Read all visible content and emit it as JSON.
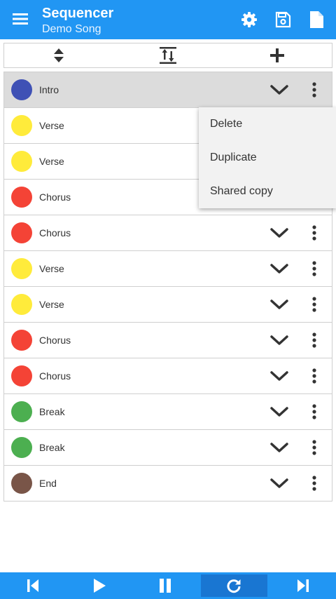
{
  "app": {
    "title": "Sequencer",
    "subtitle": "Demo Song"
  },
  "colors": {
    "primary": "#2196f3",
    "primary_dark": "#1976d2",
    "yellow": "#ffeb3b",
    "red": "#f44336",
    "indigo": "#3f51b5",
    "green": "#4caf50",
    "brown": "#795548"
  },
  "toolbar": {
    "icons": [
      "sort-icon",
      "vertical-expand-icon",
      "add-icon"
    ]
  },
  "rows": [
    {
      "label": "Intro",
      "color": "#3f51b5",
      "selected": true
    },
    {
      "label": "Verse",
      "color": "#ffeb3b"
    },
    {
      "label": "Verse",
      "color": "#ffeb3b"
    },
    {
      "label": "Chorus",
      "color": "#f44336"
    },
    {
      "label": "Chorus",
      "color": "#f44336"
    },
    {
      "label": "Verse",
      "color": "#ffeb3b"
    },
    {
      "label": "Verse",
      "color": "#ffeb3b"
    },
    {
      "label": "Chorus",
      "color": "#f44336"
    },
    {
      "label": "Chorus",
      "color": "#f44336"
    },
    {
      "label": "Break",
      "color": "#4caf50"
    },
    {
      "label": "Break",
      "color": "#4caf50"
    },
    {
      "label": "End",
      "color": "#795548"
    }
  ],
  "popup": {
    "items": [
      "Delete",
      "Duplicate",
      "Shared copy"
    ]
  },
  "transport": {
    "icons": [
      "skip-previous-icon",
      "play-icon",
      "pause-icon",
      "repeat-icon",
      "skip-next-icon"
    ],
    "active_index": 3
  }
}
